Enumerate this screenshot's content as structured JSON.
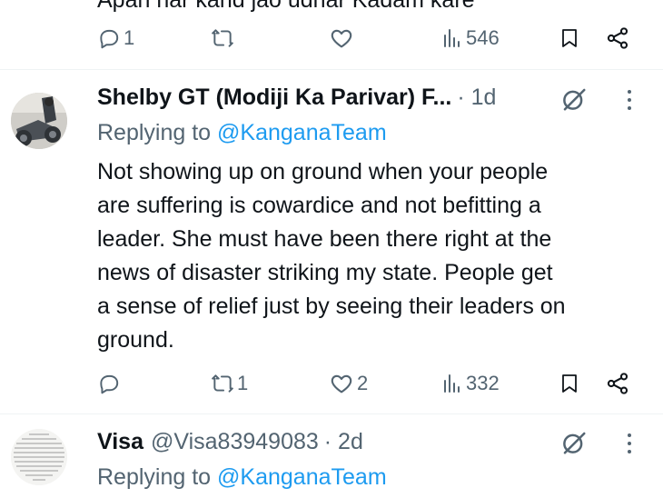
{
  "prev_tweet": {
    "cut_text": "Apan har kand jao udhar Kadam kare",
    "actions": {
      "replies": "1",
      "reposts": "",
      "likes": "",
      "views": "546"
    }
  },
  "tweet1": {
    "name": "Shelby GT (Modiji Ka Parivar) F...",
    "time": "· 1d",
    "replying_prefix": "Replying to ",
    "replying_handle": "@KanganaTeam",
    "text": "Not showing up on ground when your people\nare suffering is cowardice and not befitting a\nleader. She must have been there right at the\nnews of disaster striking my state. People get\na sense of relief just by seeing their leaders on\nground.",
    "actions": {
      "replies": "",
      "reposts": "1",
      "likes": "2",
      "views": "332"
    }
  },
  "tweet2": {
    "name": "Visa",
    "handle": "@Visa83949083",
    "time": "· 2d",
    "replying_prefix": "Replying to ",
    "replying_handle": "@KanganaTeam"
  },
  "colors": {
    "link": "#1d9bf0",
    "muted": "#536471",
    "text": "#0f1419",
    "divider": "#eff3f4"
  },
  "icons": [
    "reply-icon",
    "repost-icon",
    "like-icon",
    "views-icon",
    "bookmark-icon",
    "share-icon",
    "grok-icon",
    "more-icon"
  ]
}
